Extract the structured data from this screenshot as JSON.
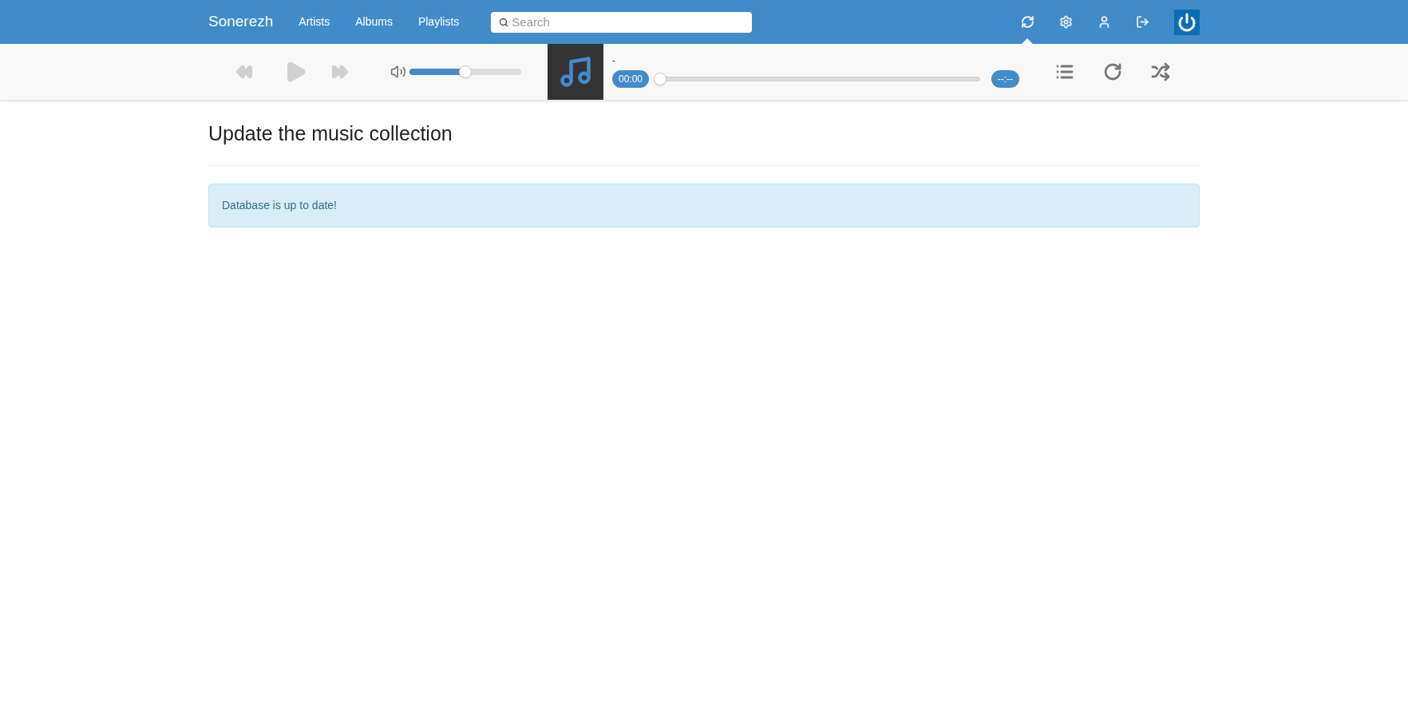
{
  "navbar": {
    "brand": "Sonerezh",
    "links": [
      {
        "label": "Artists",
        "selected": false
      },
      {
        "label": "Albums",
        "selected": false
      },
      {
        "label": "Playlists",
        "selected": false
      }
    ],
    "search": {
      "placeholder": "Search"
    },
    "icons": [
      {
        "kind": "refresh",
        "selected": true
      },
      {
        "kind": "settings",
        "selected": false
      },
      {
        "kind": "user",
        "selected": false
      },
      {
        "kind": "logout",
        "selected": false
      }
    ]
  },
  "player": {
    "controls_disabled": true,
    "volume": {
      "level": 0.5
    },
    "track_title": "-",
    "elapsed": "00:00",
    "remaining": "--:--",
    "progress": {
      "level": 0
    },
    "actions": [
      {
        "kind": "queue"
      },
      {
        "kind": "repeat"
      },
      {
        "kind": "shuffle"
      }
    ]
  },
  "page": {
    "title": "Update the music collection",
    "alert": "Database is up to date!"
  }
}
